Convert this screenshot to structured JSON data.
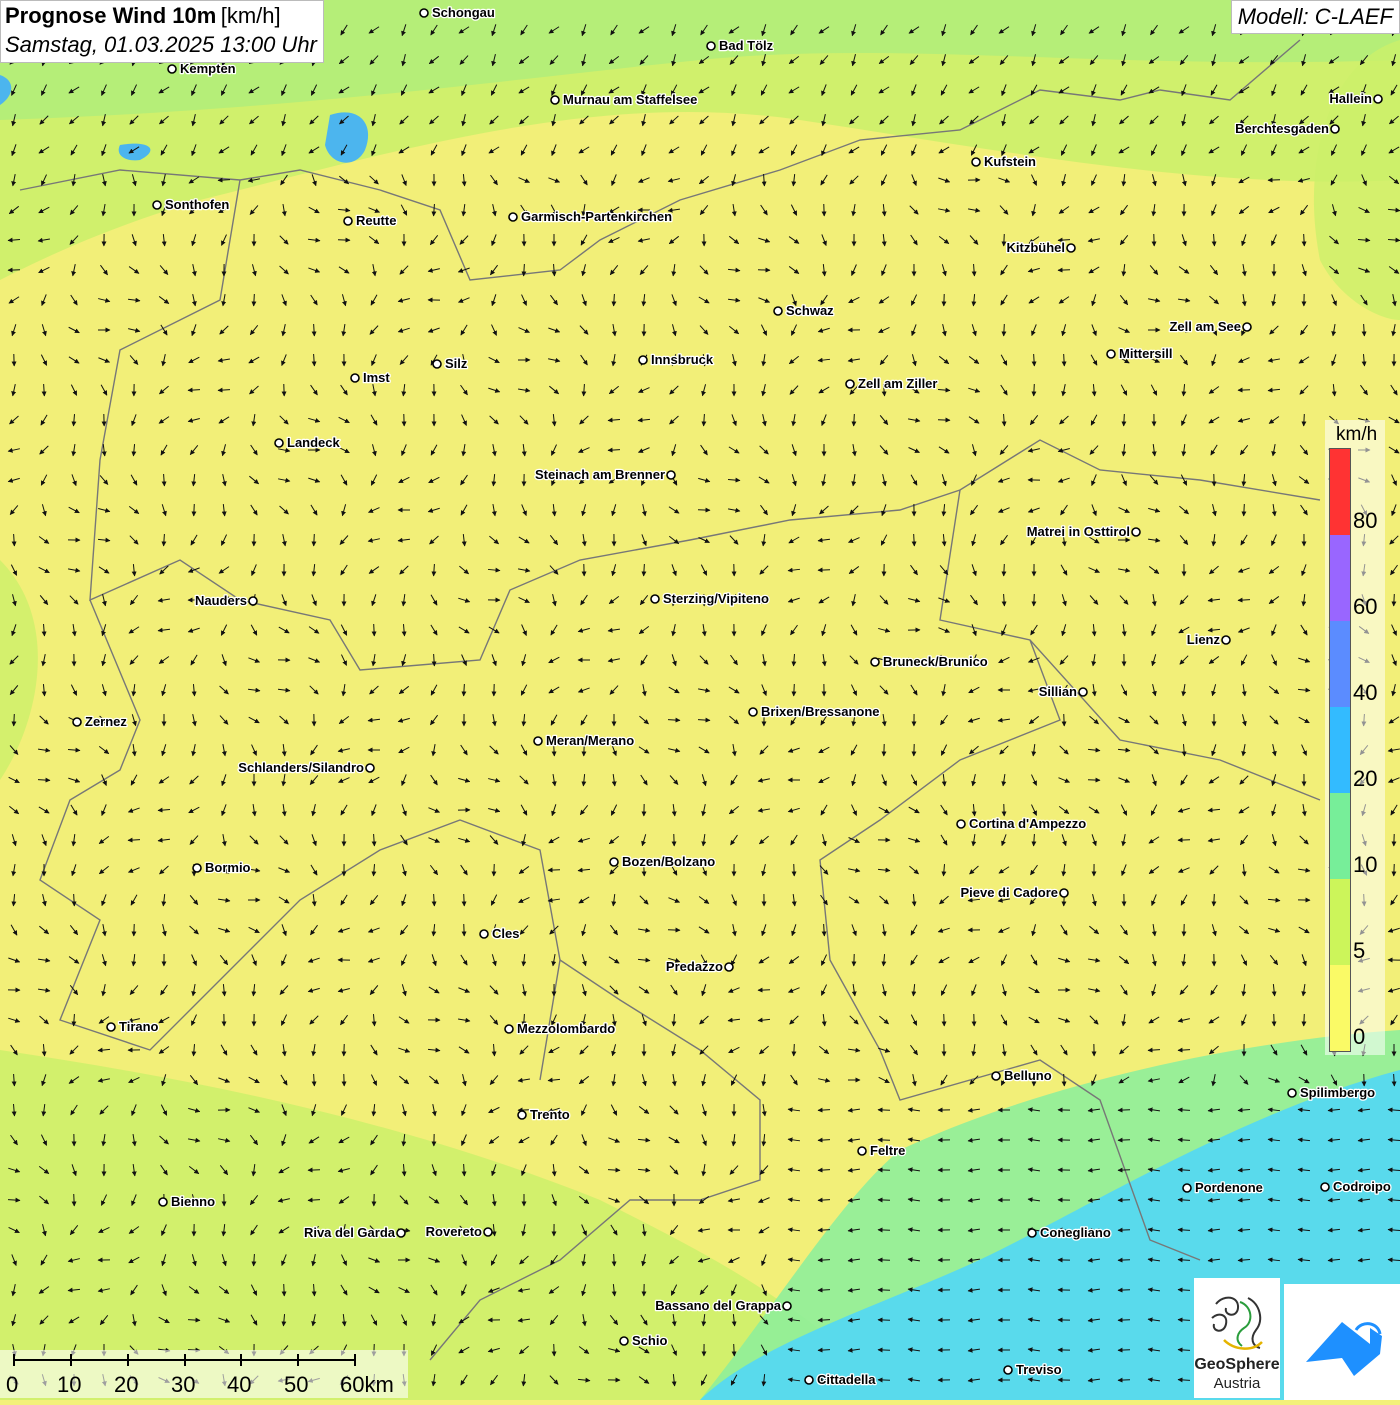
{
  "title": {
    "main": "Prognose Wind 10m",
    "unit": "[km/h]",
    "date": "Samstag, 01.03.2025 13:00 Uhr"
  },
  "model": "Modell: C-LAEF",
  "legend": {
    "unit": "km/h",
    "ticks": [
      "80",
      "60",
      "40",
      "20",
      "10",
      "5",
      "0"
    ],
    "colors": [
      "#ff3333",
      "#9966ff",
      "#5b8cff",
      "#33bbff",
      "#77ee99",
      "#ccf55a",
      "#fafa66"
    ]
  },
  "scalebar": {
    "labels": [
      "0",
      "10",
      "20",
      "30",
      "40",
      "50",
      "60km"
    ]
  },
  "logo": {
    "line1": "GeoSphere",
    "line2": "Austria"
  },
  "cities": [
    {
      "name": "Schongau"
    },
    {
      "name": "Kempten"
    },
    {
      "name": "Bad Tölz"
    },
    {
      "name": "Murnau am Staffelsee"
    },
    {
      "name": "Hallein"
    },
    {
      "name": "Berchtesgaden"
    },
    {
      "name": "Kufstein"
    },
    {
      "name": "Sonthofen"
    },
    {
      "name": "Reutte"
    },
    {
      "name": "Garmisch-Partenkirchen"
    },
    {
      "name": "Kitzbühel"
    },
    {
      "name": "Schwaz"
    },
    {
      "name": "Zell am See"
    },
    {
      "name": "Mittersill"
    },
    {
      "name": "Silz"
    },
    {
      "name": "Innsbruck"
    },
    {
      "name": "Imst"
    },
    {
      "name": "Zell am Ziller"
    },
    {
      "name": "Landeck"
    },
    {
      "name": "Steinach am Brenner"
    },
    {
      "name": "Matrei in Osttirol"
    },
    {
      "name": "Nauders"
    },
    {
      "name": "Sterzing/Vipiteno"
    },
    {
      "name": "Lienz"
    },
    {
      "name": "Bruneck/Brunico"
    },
    {
      "name": "Sillian"
    },
    {
      "name": "Zernez"
    },
    {
      "name": "Brixen/Bressanone"
    },
    {
      "name": "Meran/Merano"
    },
    {
      "name": "Schlanders/Silandro"
    },
    {
      "name": "Cortina d'Ampezzo"
    },
    {
      "name": "Bozen/Bolzano"
    },
    {
      "name": "Bormio"
    },
    {
      "name": "Pieve di Cadore"
    },
    {
      "name": "Cles"
    },
    {
      "name": "Predazzo"
    },
    {
      "name": "Tirano"
    },
    {
      "name": "Mezzolombardo"
    },
    {
      "name": "Belluno"
    },
    {
      "name": "Spilimbergo"
    },
    {
      "name": "Trento"
    },
    {
      "name": "Feltre"
    },
    {
      "name": "Pordenone"
    },
    {
      "name": "Codroipo"
    },
    {
      "name": "Bienno"
    },
    {
      "name": "Riva del Garda"
    },
    {
      "name": "Rovereto"
    },
    {
      "name": "Conegliano"
    },
    {
      "name": "Bassano del Grappa"
    },
    {
      "name": "Schio"
    },
    {
      "name": "Treviso"
    },
    {
      "name": "Cittadella"
    }
  ]
}
